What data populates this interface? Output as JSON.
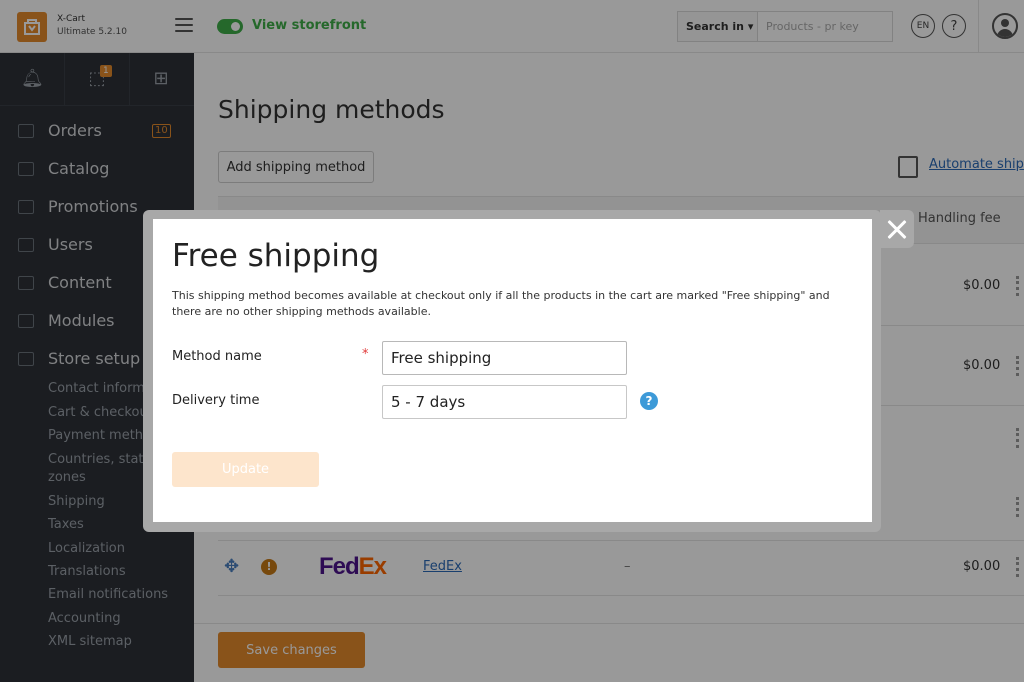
{
  "topbar": {
    "brand_name": "X-Cart",
    "brand_edition": "Ultimate 5.2.10",
    "storefront_label": "View storefront",
    "search_in_label": "Search in",
    "search_placeholder": "Products - pr key",
    "lang_label": "EN",
    "help_label": "?"
  },
  "sidebar": {
    "updates_badge": "1",
    "items": [
      {
        "label": "Orders",
        "icon": "orders-icon",
        "badge": "10"
      },
      {
        "label": "Catalog",
        "icon": "catalog-icon"
      },
      {
        "label": "Promotions",
        "icon": "promotions-icon"
      },
      {
        "label": "Users",
        "icon": "users-icon"
      },
      {
        "label": "Content",
        "icon": "content-icon"
      },
      {
        "label": "Modules",
        "icon": "modules-icon"
      },
      {
        "label": "Store setup",
        "icon": "store-setup-icon"
      }
    ],
    "subitems": [
      "Contact informa",
      "Cart & checkou",
      "Payment metho",
      "Countries, state",
      "zones",
      "Shipping",
      "Taxes",
      "Localization",
      "Translations",
      "Email notifications",
      "Accounting",
      "XML sitemap"
    ]
  },
  "main": {
    "title": "Shipping methods",
    "add_button": "Add shipping method",
    "automate_link": "Automate ship",
    "table_header_handling": "Handling fee",
    "rows": [
      {
        "fee": "$0.00"
      },
      {
        "fee": "$0.00"
      },
      {
        "carrier_logo": "FedEx",
        "carrier_logo_fd": "Fed",
        "carrier_logo_ex": "Ex",
        "link": "FedEx",
        "dash": "–",
        "fee": "$0.00"
      }
    ],
    "save_button": "Save changes"
  },
  "modal": {
    "title": "Free shipping",
    "description": "This shipping method becomes available at checkout only if all the products in the cart are marked \"Free shipping\" and there are no other shipping methods available.",
    "method_name_label": "Method name",
    "required_mark": "*",
    "method_name_value": "Free shipping",
    "delivery_time_label": "Delivery time",
    "delivery_time_value": "5 - 7 days",
    "help_glyph": "?",
    "update_button": "Update"
  },
  "colors": {
    "accent": "#e58a2c",
    "storefront_green": "#3fae49",
    "link_blue": "#2a6ab8",
    "help_blue": "#3d9ad8",
    "required_red": "#e03a3a",
    "update_disabled": "#fde5cc"
  }
}
